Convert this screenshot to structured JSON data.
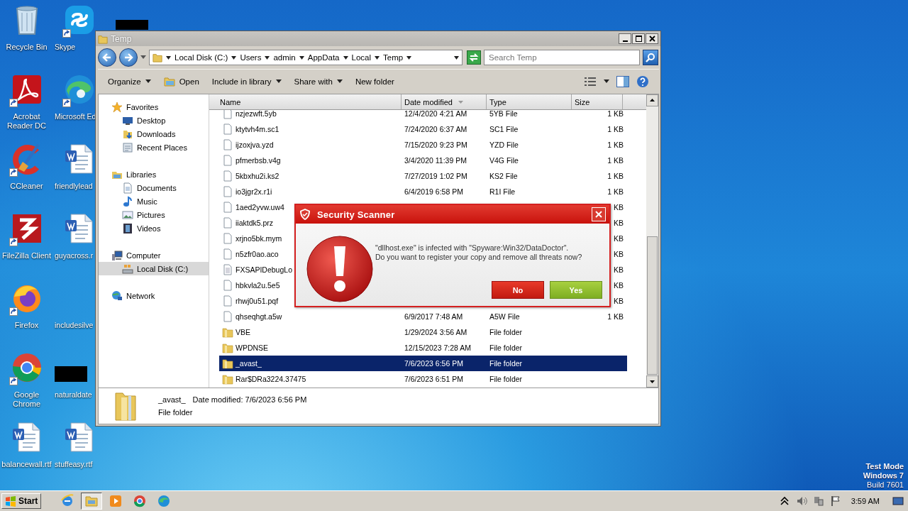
{
  "desktop": {
    "icons": [
      {
        "label": "Recycle Bin",
        "kind": "bin",
        "shortcut": false
      },
      {
        "label": "Skype",
        "kind": "skype",
        "shortcut": true
      },
      {
        "label": "Acrobat Reader DC",
        "kind": "acrobat",
        "shortcut": true
      },
      {
        "label": "Microsoft Ed",
        "kind": "edge",
        "shortcut": true
      },
      {
        "label": "CCleaner",
        "kind": "ccleaner",
        "shortcut": true
      },
      {
        "label": "friendlylead",
        "kind": "word",
        "shortcut": false
      },
      {
        "label": "FileZilla Client",
        "kind": "filezilla",
        "shortcut": true
      },
      {
        "label": "guyacross.r",
        "kind": "word",
        "shortcut": false
      },
      {
        "label": "Firefox",
        "kind": "firefox",
        "shortcut": true
      },
      {
        "label": "includesilve",
        "kind": "blank",
        "shortcut": false
      },
      {
        "label": "Google Chrome",
        "kind": "chrome",
        "shortcut": true
      },
      {
        "label": "naturaldate",
        "kind": "redacted",
        "shortcut": false
      },
      {
        "label": "balancewall.rtf",
        "kind": "word",
        "shortcut": false
      },
      {
        "label": "stuffeasy.rtf",
        "kind": "word",
        "shortcut": false
      }
    ],
    "system_text": [
      "Test Mode",
      "Windows 7",
      "Build 7601"
    ]
  },
  "window": {
    "title": "Temp",
    "breadcrumbs": [
      "Local Disk (C:)",
      "Users",
      "admin",
      "AppData",
      "Local",
      "Temp"
    ],
    "search": {
      "placeholder": "Search Temp"
    },
    "toolbar": [
      {
        "label": "Organize",
        "kind": "menu"
      },
      {
        "label": "Open",
        "kind": "open"
      },
      {
        "label": "Include in library",
        "kind": "menu"
      },
      {
        "label": "Share with",
        "kind": "menu"
      },
      {
        "label": "New folder",
        "kind": "plain"
      }
    ],
    "nav": [
      {
        "label": "Favorites",
        "kind": "star",
        "selected": false,
        "children": [
          {
            "label": "Desktop",
            "kind": "desktop",
            "selected": false
          },
          {
            "label": "Downloads",
            "kind": "downloads",
            "selected": false
          },
          {
            "label": "Recent Places",
            "kind": "recent",
            "selected": false
          }
        ]
      },
      {
        "label": "Libraries",
        "kind": "library",
        "selected": false,
        "children": [
          {
            "label": "Documents",
            "kind": "documents",
            "selected": false
          },
          {
            "label": "Music",
            "kind": "music",
            "selected": false
          },
          {
            "label": "Pictures",
            "kind": "pictures",
            "selected": false
          },
          {
            "label": "Videos",
            "kind": "videos",
            "selected": false
          }
        ]
      },
      {
        "label": "Computer",
        "kind": "computer",
        "selected": false,
        "children": [
          {
            "label": "Local Disk (C:)",
            "kind": "disk",
            "selected": true
          }
        ]
      },
      {
        "label": "Network",
        "kind": "network",
        "selected": false
      }
    ],
    "columns": [
      {
        "label": "Name",
        "sorted": false
      },
      {
        "label": "Date modified",
        "sorted": true
      },
      {
        "label": "Type",
        "sorted": false
      },
      {
        "label": "Size",
        "sorted": false
      }
    ],
    "rows": [
      {
        "name": "nzjezwft.5yb",
        "date": "12/4/2020 4:21 AM",
        "type": "5YB File",
        "size": "1 KB",
        "kind": "file",
        "selected": false
      },
      {
        "name": "ktytvh4m.sc1",
        "date": "7/24/2020 6:37 AM",
        "type": "SC1 File",
        "size": "1 KB",
        "kind": "file",
        "selected": false
      },
      {
        "name": "ijzoxjva.yzd",
        "date": "7/15/2020 9:23 PM",
        "type": "YZD File",
        "size": "1 KB",
        "kind": "file",
        "selected": false
      },
      {
        "name": "pfmerbsb.v4g",
        "date": "3/4/2020 11:39 PM",
        "type": "V4G File",
        "size": "1 KB",
        "kind": "file",
        "selected": false
      },
      {
        "name": "5kbxhu2i.ks2",
        "date": "7/27/2019 1:02 PM",
        "type": "KS2 File",
        "size": "1 KB",
        "kind": "file",
        "selected": false
      },
      {
        "name": "io3jgr2x.r1i",
        "date": "6/4/2019 6:58 PM",
        "type": "R1I File",
        "size": "1 KB",
        "kind": "file",
        "selected": false
      },
      {
        "name": "1aed2yvw.uw4",
        "size": "KB",
        "kind": "file",
        "selected": false
      },
      {
        "name": "iiaktdk5.prz",
        "size": "KB",
        "kind": "file",
        "selected": false
      },
      {
        "name": "xrjno5bk.mym",
        "size": "KB",
        "kind": "file",
        "selected": false
      },
      {
        "name": "n5zfr0ao.aco",
        "size": "KB",
        "kind": "file",
        "selected": false
      },
      {
        "name": "FXSAPIDebugLo",
        "size": "KB",
        "kind": "text",
        "selected": false
      },
      {
        "name": "hbkvla2u.5e5",
        "size": "KB",
        "kind": "file",
        "selected": false
      },
      {
        "name": "rhwj0u51.pqf",
        "size": "KB",
        "kind": "file",
        "selected": false
      },
      {
        "name": "qhseqhgt.a5w",
        "date": "6/9/2017 7:48 AM",
        "type": "A5W File",
        "size": "1 KB",
        "kind": "file",
        "selected": false
      },
      {
        "name": "VBE",
        "date": "1/29/2024 3:56 AM",
        "type": "File folder",
        "kind": "folder",
        "selected": false
      },
      {
        "name": "WPDNSE",
        "date": "12/15/2023 7:28 AM",
        "type": "File folder",
        "kind": "folder",
        "selected": false
      },
      {
        "name": "_avast_",
        "date": "7/6/2023 6:56 PM",
        "type": "File folder",
        "kind": "folder",
        "selected": true
      },
      {
        "name": "Rar$DRa3224.37475",
        "date": "7/6/2023 6:51 PM",
        "type": "File folder",
        "kind": "folder",
        "selected": false
      }
    ],
    "details": {
      "name": "_avast_",
      "date_label": "Date modified:",
      "date": "7/6/2023 6:56 PM",
      "type": "File folder"
    }
  },
  "dialog": {
    "title": "Security Scanner",
    "message": [
      "\"dllhost.exe\" is infected with \"Spyware:Win32/DataDoctor\".",
      "Do you want to register your copy and remove all threats now?"
    ],
    "buttons": [
      {
        "label": "No",
        "kind": "decline"
      },
      {
        "label": "Yes",
        "kind": "accept"
      }
    ]
  },
  "taskbar": {
    "start": "Start",
    "apps": [
      {
        "kind": "ie",
        "active": false
      },
      {
        "kind": "explorer",
        "active": true
      },
      {
        "kind": "media",
        "active": false
      },
      {
        "kind": "chrome",
        "active": false
      },
      {
        "kind": "edge",
        "active": false
      }
    ],
    "clock": "3:59 AM"
  }
}
